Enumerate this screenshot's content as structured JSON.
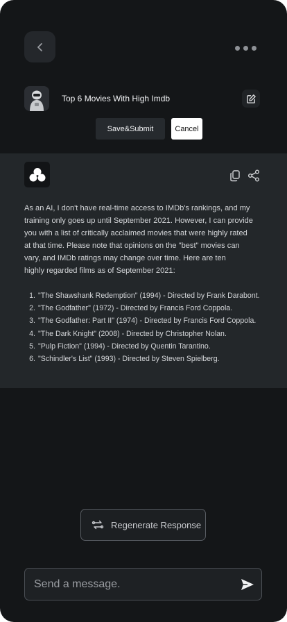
{
  "header": {
    "back_icon": "chevron-left-icon",
    "more_icon": "more-horizontal-icon"
  },
  "conversation": {
    "title": "Top 6 Movies With High Imdb",
    "edit_icon": "edit-icon",
    "save_label": "Save&Submit",
    "cancel_label": "Cancel"
  },
  "response": {
    "logo_icon": "bot-logo-icon",
    "copy_icon": "copy-icon",
    "share_icon": "share-icon",
    "intro_lines": [
      "As an AI, I don't have real-time access to IMDb's rankings, and my",
      "training only goes up until September 2021. However, I can provide",
      "you with a list of critically acclaimed movies that were highly rated",
      "at that time. Please note that opinions on the \"best\" movies can",
      "vary, and IMDb ratings may change over time. Here are ten",
      "highly regarded films as of September 2021:"
    ],
    "movies": [
      {
        "num": "1.",
        "text": "\"The Shawshank Redemption\" (1994) - Directed by Frank Darabont."
      },
      {
        "num": "2.",
        "text": "\"The Godfather\" (1972) - Directed by Francis Ford Coppola."
      },
      {
        "num": "3.",
        "text": "\"The Godfather: Part II\" (1974) - Directed by Francis Ford Coppola."
      },
      {
        "num": "4.",
        "text": "\"The Dark Knight\" (2008) - Directed by Christopher Nolan."
      },
      {
        "num": "5.",
        "text": "\"Pulp Fiction\" (1994) - Directed by Quentin Tarantino."
      },
      {
        "num": "6.",
        "text": "\"Schindler's List\" (1993) - Directed by Steven Spielberg."
      }
    ]
  },
  "footer": {
    "regenerate_label": "Regenerate Response",
    "regenerate_icon": "refresh-icon",
    "message_placeholder": "Send a message.",
    "send_icon": "send-icon"
  }
}
